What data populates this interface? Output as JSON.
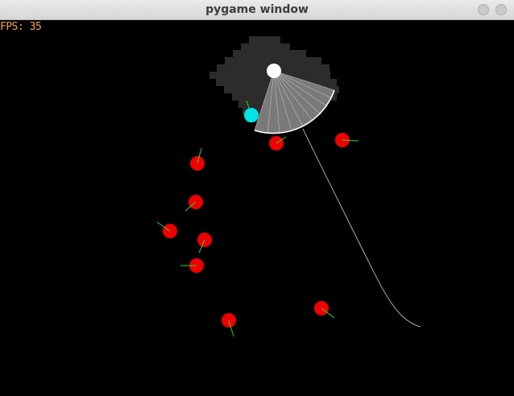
{
  "window": {
    "title": "pygame window"
  },
  "hud": {
    "fps_text": "FPS: 35"
  },
  "colors": {
    "background": "#000000",
    "explored_area": "#2c2c2c",
    "vision_cone": "#7a7a7a",
    "vision_rays": "#bdbdbd",
    "path": "#d8d8d8",
    "player": "#ffffff",
    "target": "#00e5e5",
    "enemy": "#ee0000",
    "heading": "#22dd22",
    "fps_text": "#f5a14b"
  },
  "icons": {
    "minimize": "minimize-icon",
    "close": "close-icon"
  }
}
